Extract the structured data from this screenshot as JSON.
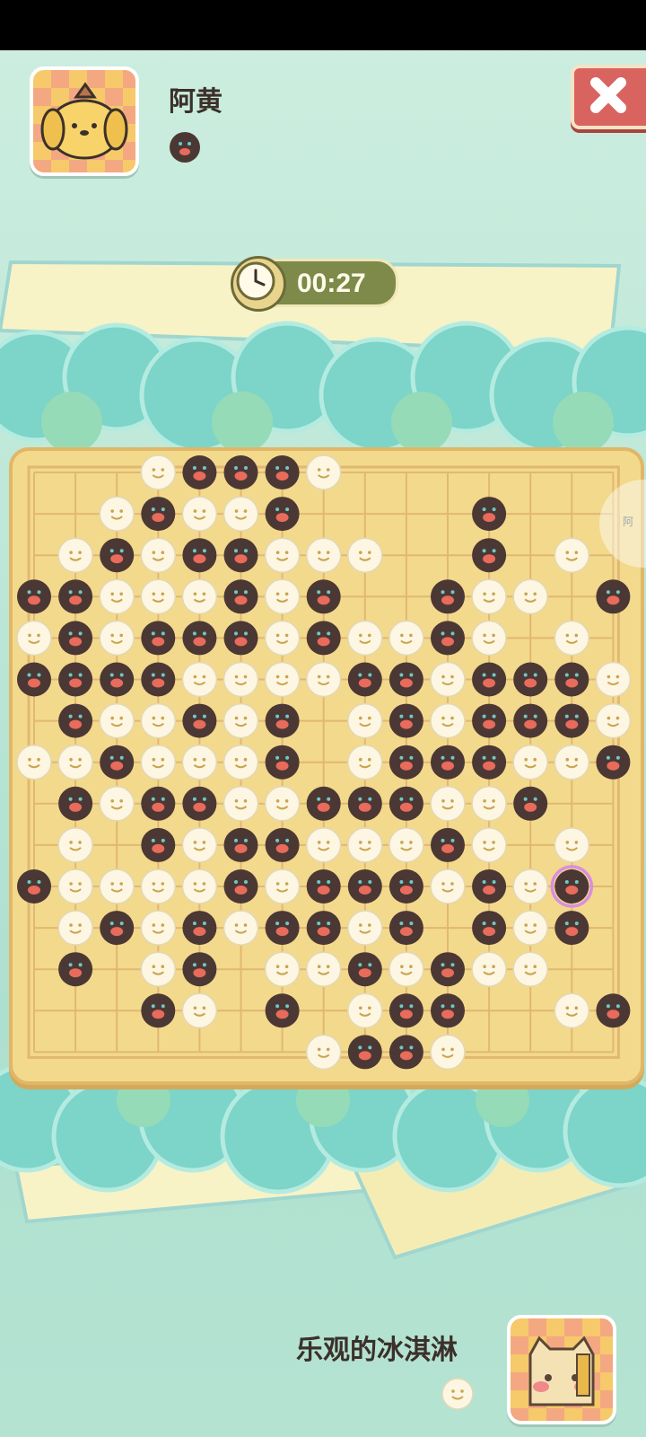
{
  "opponent": {
    "name": "阿黄",
    "stone": "black"
  },
  "self": {
    "name": "乐观的冰淇淋",
    "stone": "white"
  },
  "timer": {
    "text": "00:27"
  },
  "side_tab_text": "阿",
  "board": {
    "size": 15,
    "last_move": [
      13,
      10
    ],
    "rows": [
      "...WBBBW.......",
      "..WBWWB....B...",
      ".WBWBBWWW..B.W.",
      "BBWWWBWB..BWW.B",
      "WBWBBBWBWWBW.W.",
      "BBBBWWWWBBWBBBW",
      ".BWWBWB.WBWBBBW",
      "WWBWWWB.WBBBWWB",
      ".BWBBWWBBBWWB..",
      ".W.BWBBWWWBW.W.",
      "BWWWWBWBBBWBWB.",
      ".WBWBWBBWB.BWB.",
      ".B.WB.WWBWBWW..",
      "...BW.B.WBB..WB",
      ".......WBBW...."
    ]
  },
  "colors": {
    "board": "#f3d98c",
    "grid": "#e1b872",
    "black_stone": "#4b3834",
    "white_stone": "#fcf6e3",
    "highlight": "#d98ee0"
  }
}
